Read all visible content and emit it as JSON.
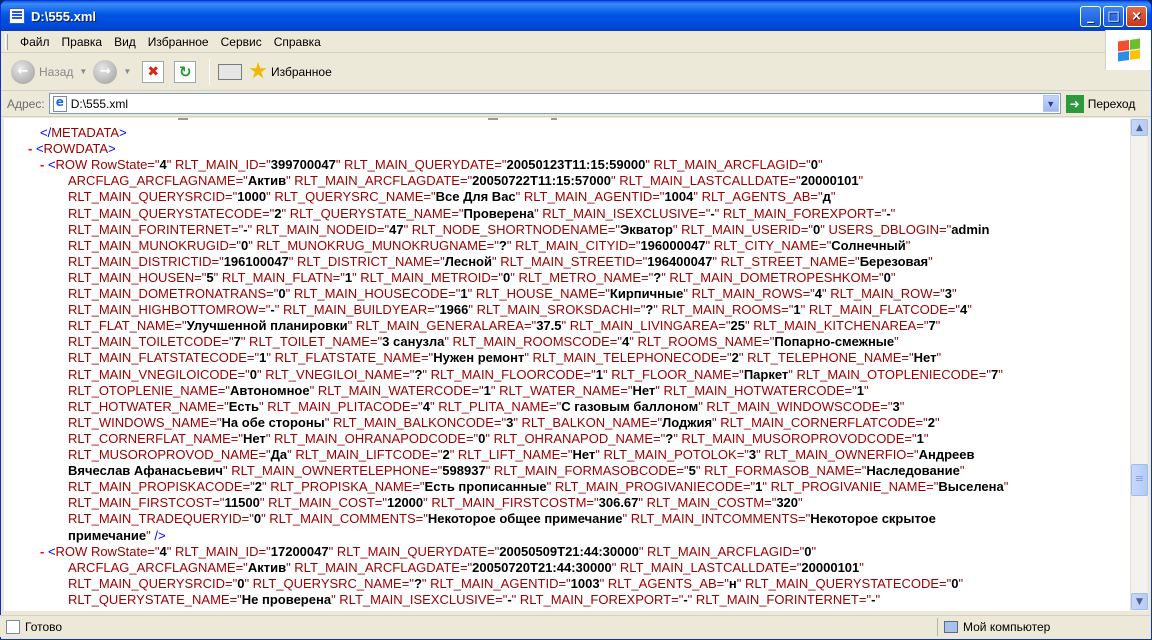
{
  "window": {
    "title": "D:\\555.xml"
  },
  "title_buttons": {
    "minimize": "_",
    "maximize": "□",
    "close": "×"
  },
  "menu": [
    "Файл",
    "Правка",
    "Вид",
    "Избранное",
    "Сервис",
    "Справка"
  ],
  "toolbar": {
    "back_label": "Назад",
    "favorites_label": "Избранное"
  },
  "address": {
    "label": "Адрес:",
    "value": "D:\\555.xml",
    "go_label": "Переход"
  },
  "status": {
    "left": "Готово",
    "right": "Мой компьютер"
  },
  "icons": [
    "windows-logo-icon",
    "back-arrow-icon",
    "forward-arrow-icon",
    "stop-icon",
    "refresh-icon",
    "media-icon",
    "favorites-star-icon",
    "page-icon",
    "go-arrow-icon",
    "my-computer-icon"
  ],
  "colors": {
    "markup": "#990000",
    "value": "#000000",
    "punct": "#0000ff",
    "minus": "#ff0000",
    "titlebar": "#0055e5"
  },
  "xml_lines": [
    [
      {
        "c": "p",
        "t": "</"
      },
      {
        "c": "t",
        "t": "METADATA"
      },
      {
        "c": "p",
        "t": ">"
      }
    ],
    [
      {
        "c": "minus",
        "t": "- "
      },
      {
        "c": "p",
        "t": "<"
      },
      {
        "c": "t",
        "t": "ROWDATA"
      },
      {
        "c": "p",
        "t": ">"
      }
    ],
    [
      {
        "c": "minus",
        "t": "- "
      },
      {
        "c": "p",
        "t": "<"
      },
      {
        "c": "t",
        "t": "ROW "
      },
      {
        "c": "a",
        "t": "RowState=\""
      },
      {
        "c": "v",
        "t": "4"
      },
      {
        "c": "a",
        "t": "\" RLT_MAIN_ID=\""
      },
      {
        "c": "v",
        "t": "399700047"
      },
      {
        "c": "a",
        "t": "\" RLT_MAIN_QUERYDATE=\""
      },
      {
        "c": "v",
        "t": "20050123T11:15:59000"
      },
      {
        "c": "a",
        "t": "\" RLT_MAIN_ARCFLAGID=\""
      },
      {
        "c": "v",
        "t": "0"
      },
      {
        "c": "a",
        "t": "\""
      }
    ],
    [
      {
        "c": "a",
        "t": "ARCFLAG_ARCFLAGNAME=\""
      },
      {
        "c": "v",
        "t": "Актив"
      },
      {
        "c": "a",
        "t": "\" RLT_MAIN_ARCFLAGDATE=\""
      },
      {
        "c": "v",
        "t": "20050722T11:15:57000"
      },
      {
        "c": "a",
        "t": "\" RLT_MAIN_LASTCALLDATE=\""
      },
      {
        "c": "v",
        "t": "20000101"
      },
      {
        "c": "a",
        "t": "\""
      }
    ],
    [
      {
        "c": "a",
        "t": "RLT_MAIN_QUERYSRCID=\""
      },
      {
        "c": "v",
        "t": "1000"
      },
      {
        "c": "a",
        "t": "\" RLT_QUERYSRC_NAME=\""
      },
      {
        "c": "v",
        "t": "Все Для Вас"
      },
      {
        "c": "a",
        "t": "\" RLT_MAIN_AGENTID=\""
      },
      {
        "c": "v",
        "t": "1004"
      },
      {
        "c": "a",
        "t": "\" RLT_AGENTS_AB=\""
      },
      {
        "c": "v",
        "t": "д"
      },
      {
        "c": "a",
        "t": "\""
      }
    ],
    [
      {
        "c": "a",
        "t": "RLT_MAIN_QUERYSTATECODE=\""
      },
      {
        "c": "v",
        "t": "2"
      },
      {
        "c": "a",
        "t": "\" RLT_QUERYSTATE_NAME=\""
      },
      {
        "c": "v",
        "t": "Проверена"
      },
      {
        "c": "a",
        "t": "\" RLT_MAIN_ISEXCLUSIVE=\""
      },
      {
        "c": "v",
        "t": "-"
      },
      {
        "c": "a",
        "t": "\" RLT_MAIN_FOREXPORT=\""
      },
      {
        "c": "v",
        "t": "-"
      },
      {
        "c": "a",
        "t": "\""
      }
    ],
    [
      {
        "c": "a",
        "t": "RLT_MAIN_FORINTERNET=\""
      },
      {
        "c": "v",
        "t": "-"
      },
      {
        "c": "a",
        "t": "\" RLT_MAIN_NODEID=\""
      },
      {
        "c": "v",
        "t": "47"
      },
      {
        "c": "a",
        "t": "\" RLT_NODE_SHORTNODENAME=\""
      },
      {
        "c": "v",
        "t": "Экватор"
      },
      {
        "c": "a",
        "t": "\" RLT_MAIN_USERID=\""
      },
      {
        "c": "v",
        "t": "0"
      },
      {
        "c": "a",
        "t": "\" USERS_DBLOGIN=\""
      },
      {
        "c": "v",
        "t": "admin"
      }
    ],
    [
      {
        "c": "a",
        "t": "RLT_MAIN_MUNOKRUGID=\""
      },
      {
        "c": "v",
        "t": "0"
      },
      {
        "c": "a",
        "t": "\" RLT_MUNOKRUG_MUNOKRUGNAME=\""
      },
      {
        "c": "v",
        "t": "?"
      },
      {
        "c": "a",
        "t": "\" RLT_MAIN_CITYID=\""
      },
      {
        "c": "v",
        "t": "196000047"
      },
      {
        "c": "a",
        "t": "\" RLT_CITY_NAME=\""
      },
      {
        "c": "v",
        "t": "Солнечный"
      },
      {
        "c": "a",
        "t": "\""
      }
    ],
    [
      {
        "c": "a",
        "t": "RLT_MAIN_DISTRICTID=\""
      },
      {
        "c": "v",
        "t": "196100047"
      },
      {
        "c": "a",
        "t": "\" RLT_DISTRICT_NAME=\""
      },
      {
        "c": "v",
        "t": "Лесной"
      },
      {
        "c": "a",
        "t": "\" RLT_MAIN_STREETID=\""
      },
      {
        "c": "v",
        "t": "196400047"
      },
      {
        "c": "a",
        "t": "\" RLT_STREET_NAME=\""
      },
      {
        "c": "v",
        "t": "Березовая"
      },
      {
        "c": "a",
        "t": "\""
      }
    ],
    [
      {
        "c": "a",
        "t": "RLT_MAIN_HOUSEN=\""
      },
      {
        "c": "v",
        "t": "5"
      },
      {
        "c": "a",
        "t": "\" RLT_MAIN_FLATN=\""
      },
      {
        "c": "v",
        "t": "1"
      },
      {
        "c": "a",
        "t": "\" RLT_MAIN_METROID=\""
      },
      {
        "c": "v",
        "t": "0"
      },
      {
        "c": "a",
        "t": "\" RLT_METRO_NAME=\""
      },
      {
        "c": "v",
        "t": "?"
      },
      {
        "c": "a",
        "t": "\" RLT_MAIN_DOMETROPESHKOM=\""
      },
      {
        "c": "v",
        "t": "0"
      },
      {
        "c": "a",
        "t": "\""
      }
    ],
    [
      {
        "c": "a",
        "t": "RLT_MAIN_DOMETRONATRANS=\""
      },
      {
        "c": "v",
        "t": "0"
      },
      {
        "c": "a",
        "t": "\" RLT_MAIN_HOUSECODE=\""
      },
      {
        "c": "v",
        "t": "1"
      },
      {
        "c": "a",
        "t": "\" RLT_HOUSE_NAME=\""
      },
      {
        "c": "v",
        "t": "Кирпичные"
      },
      {
        "c": "a",
        "t": "\" RLT_MAIN_ROWS=\""
      },
      {
        "c": "v",
        "t": "4"
      },
      {
        "c": "a",
        "t": "\" RLT_MAIN_ROW=\""
      },
      {
        "c": "v",
        "t": "3"
      },
      {
        "c": "a",
        "t": "\""
      }
    ],
    [
      {
        "c": "a",
        "t": "RLT_MAIN_HIGHBOTTOMROW=\""
      },
      {
        "c": "v",
        "t": "-"
      },
      {
        "c": "a",
        "t": "\" RLT_MAIN_BUILDYEAR=\""
      },
      {
        "c": "v",
        "t": "1966"
      },
      {
        "c": "a",
        "t": "\" RLT_MAIN_SROKSDACHI=\""
      },
      {
        "c": "v",
        "t": "?"
      },
      {
        "c": "a",
        "t": "\" RLT_MAIN_ROOMS=\""
      },
      {
        "c": "v",
        "t": "1"
      },
      {
        "c": "a",
        "t": "\" RLT_MAIN_FLATCODE=\""
      },
      {
        "c": "v",
        "t": "4"
      },
      {
        "c": "a",
        "t": "\""
      }
    ],
    [
      {
        "c": "a",
        "t": "RLT_FLAT_NAME=\""
      },
      {
        "c": "v",
        "t": "Улучшенной планировки"
      },
      {
        "c": "a",
        "t": "\" RLT_MAIN_GENERALAREA=\""
      },
      {
        "c": "v",
        "t": "37.5"
      },
      {
        "c": "a",
        "t": "\" RLT_MAIN_LIVINGAREA=\""
      },
      {
        "c": "v",
        "t": "25"
      },
      {
        "c": "a",
        "t": "\" RLT_MAIN_KITCHENAREA=\""
      },
      {
        "c": "v",
        "t": "7"
      },
      {
        "c": "a",
        "t": "\""
      }
    ],
    [
      {
        "c": "a",
        "t": "RLT_MAIN_TOILETCODE=\""
      },
      {
        "c": "v",
        "t": "7"
      },
      {
        "c": "a",
        "t": "\" RLT_TOILET_NAME=\""
      },
      {
        "c": "v",
        "t": "3 санузла"
      },
      {
        "c": "a",
        "t": "\" RLT_MAIN_ROOMSCODE=\""
      },
      {
        "c": "v",
        "t": "4"
      },
      {
        "c": "a",
        "t": "\" RLT_ROOMS_NAME=\""
      },
      {
        "c": "v",
        "t": "Попарно-смежные"
      },
      {
        "c": "a",
        "t": "\""
      }
    ],
    [
      {
        "c": "a",
        "t": "RLT_MAIN_FLATSTATECODE=\""
      },
      {
        "c": "v",
        "t": "1"
      },
      {
        "c": "a",
        "t": "\" RLT_FLATSTATE_NAME=\""
      },
      {
        "c": "v",
        "t": "Нужен ремонт"
      },
      {
        "c": "a",
        "t": "\" RLT_MAIN_TELEPHONECODE=\""
      },
      {
        "c": "v",
        "t": "2"
      },
      {
        "c": "a",
        "t": "\" RLT_TELEPHONE_NAME=\""
      },
      {
        "c": "v",
        "t": "Нет"
      },
      {
        "c": "a",
        "t": "\""
      }
    ],
    [
      {
        "c": "a",
        "t": "RLT_MAIN_VNEGILOICODE=\""
      },
      {
        "c": "v",
        "t": "0"
      },
      {
        "c": "a",
        "t": "\" RLT_VNEGILOI_NAME=\""
      },
      {
        "c": "v",
        "t": "?"
      },
      {
        "c": "a",
        "t": "\" RLT_MAIN_FLOORCODE=\""
      },
      {
        "c": "v",
        "t": "1"
      },
      {
        "c": "a",
        "t": "\" RLT_FLOOR_NAME=\""
      },
      {
        "c": "v",
        "t": "Паркет"
      },
      {
        "c": "a",
        "t": "\" RLT_MAIN_OTOPLENIECODE=\""
      },
      {
        "c": "v",
        "t": "7"
      },
      {
        "c": "a",
        "t": "\""
      }
    ],
    [
      {
        "c": "a",
        "t": "RLT_OTOPLENIE_NAME=\""
      },
      {
        "c": "v",
        "t": "Автономное"
      },
      {
        "c": "a",
        "t": "\" RLT_MAIN_WATERCODE=\""
      },
      {
        "c": "v",
        "t": "1"
      },
      {
        "c": "a",
        "t": "\" RLT_WATER_NAME=\""
      },
      {
        "c": "v",
        "t": "Нет"
      },
      {
        "c": "a",
        "t": "\" RLT_MAIN_HOTWATERCODE=\""
      },
      {
        "c": "v",
        "t": "1"
      },
      {
        "c": "a",
        "t": "\""
      }
    ],
    [
      {
        "c": "a",
        "t": "RLT_HOTWATER_NAME=\""
      },
      {
        "c": "v",
        "t": "Есть"
      },
      {
        "c": "a",
        "t": "\" RLT_MAIN_PLITACODE=\""
      },
      {
        "c": "v",
        "t": "4"
      },
      {
        "c": "a",
        "t": "\" RLT_PLITA_NAME=\""
      },
      {
        "c": "v",
        "t": "С газовым баллоном"
      },
      {
        "c": "a",
        "t": "\" RLT_MAIN_WINDOWSCODE=\""
      },
      {
        "c": "v",
        "t": "3"
      },
      {
        "c": "a",
        "t": "\""
      }
    ],
    [
      {
        "c": "a",
        "t": "RLT_WINDOWS_NAME=\""
      },
      {
        "c": "v",
        "t": "На обе стороны"
      },
      {
        "c": "a",
        "t": "\" RLT_MAIN_BALKONCODE=\""
      },
      {
        "c": "v",
        "t": "3"
      },
      {
        "c": "a",
        "t": "\" RLT_BALKON_NAME=\""
      },
      {
        "c": "v",
        "t": "Лоджия"
      },
      {
        "c": "a",
        "t": "\" RLT_MAIN_CORNERFLATCODE=\""
      },
      {
        "c": "v",
        "t": "2"
      },
      {
        "c": "a",
        "t": "\""
      }
    ],
    [
      {
        "c": "a",
        "t": "RLT_CORNERFLAT_NAME=\""
      },
      {
        "c": "v",
        "t": "Нет"
      },
      {
        "c": "a",
        "t": "\" RLT_MAIN_OHRANAPODCODE=\""
      },
      {
        "c": "v",
        "t": "0"
      },
      {
        "c": "a",
        "t": "\" RLT_OHRANAPOD_NAME=\""
      },
      {
        "c": "v",
        "t": "?"
      },
      {
        "c": "a",
        "t": "\" RLT_MAIN_MUSOROPROVODCODE=\""
      },
      {
        "c": "v",
        "t": "1"
      },
      {
        "c": "a",
        "t": "\""
      }
    ],
    [
      {
        "c": "a",
        "t": "RLT_MUSOROPROVOD_NAME=\""
      },
      {
        "c": "v",
        "t": "Да"
      },
      {
        "c": "a",
        "t": "\" RLT_MAIN_LIFTCODE=\""
      },
      {
        "c": "v",
        "t": "2"
      },
      {
        "c": "a",
        "t": "\" RLT_LIFT_NAME=\""
      },
      {
        "c": "v",
        "t": "Нет"
      },
      {
        "c": "a",
        "t": "\" RLT_MAIN_POTOLOK=\""
      },
      {
        "c": "v",
        "t": "3"
      },
      {
        "c": "a",
        "t": "\" RLT_MAIN_OWNERFIO=\""
      },
      {
        "c": "v",
        "t": "Андреев"
      }
    ],
    [
      {
        "c": "v",
        "t": "Вячеслав Афанасьевич"
      },
      {
        "c": "a",
        "t": "\" RLT_MAIN_OWNERTELEPHONE=\""
      },
      {
        "c": "v",
        "t": "598937"
      },
      {
        "c": "a",
        "t": "\" RLT_MAIN_FORMASOBCODE=\""
      },
      {
        "c": "v",
        "t": "5"
      },
      {
        "c": "a",
        "t": "\" RLT_FORMASOB_NAME=\""
      },
      {
        "c": "v",
        "t": "Наследование"
      },
      {
        "c": "a",
        "t": "\""
      }
    ],
    [
      {
        "c": "a",
        "t": "RLT_MAIN_PROPISKACODE=\""
      },
      {
        "c": "v",
        "t": "2"
      },
      {
        "c": "a",
        "t": "\" RLT_PROPISKA_NAME=\""
      },
      {
        "c": "v",
        "t": "Есть прописанные"
      },
      {
        "c": "a",
        "t": "\" RLT_MAIN_PROGIVANIECODE=\""
      },
      {
        "c": "v",
        "t": "1"
      },
      {
        "c": "a",
        "t": "\" RLT_PROGIVANIE_NAME=\""
      },
      {
        "c": "v",
        "t": "Выселена"
      },
      {
        "c": "a",
        "t": "\""
      }
    ],
    [
      {
        "c": "a",
        "t": "RLT_MAIN_FIRSTCOST=\""
      },
      {
        "c": "v",
        "t": "11500"
      },
      {
        "c": "a",
        "t": "\" RLT_MAIN_COST=\""
      },
      {
        "c": "v",
        "t": "12000"
      },
      {
        "c": "a",
        "t": "\" RLT_MAIN_FIRSTCOSTM=\""
      },
      {
        "c": "v",
        "t": "306.67"
      },
      {
        "c": "a",
        "t": "\" RLT_MAIN_COSTM=\""
      },
      {
        "c": "v",
        "t": "320"
      },
      {
        "c": "a",
        "t": "\""
      }
    ],
    [
      {
        "c": "a",
        "t": "RLT_MAIN_TRADEQUERYID=\""
      },
      {
        "c": "v",
        "t": "0"
      },
      {
        "c": "a",
        "t": "\" RLT_MAIN_COMMENTS=\""
      },
      {
        "c": "v",
        "t": "Некоторое общее примечание"
      },
      {
        "c": "a",
        "t": "\" RLT_MAIN_INTCOMMENTS=\""
      },
      {
        "c": "v",
        "t": "Некоторое скрытое"
      }
    ],
    [
      {
        "c": "v",
        "t": "примечание"
      },
      {
        "c": "a",
        "t": "\" "
      },
      {
        "c": "p",
        "t": "/>"
      }
    ],
    [
      {
        "c": "minus",
        "t": "- "
      },
      {
        "c": "p",
        "t": "<"
      },
      {
        "c": "t",
        "t": "ROW "
      },
      {
        "c": "a",
        "t": "RowState=\""
      },
      {
        "c": "v",
        "t": "4"
      },
      {
        "c": "a",
        "t": "\" RLT_MAIN_ID=\""
      },
      {
        "c": "v",
        "t": "17200047"
      },
      {
        "c": "a",
        "t": "\" RLT_MAIN_QUERYDATE=\""
      },
      {
        "c": "v",
        "t": "20050509T21:44:30000"
      },
      {
        "c": "a",
        "t": "\" RLT_MAIN_ARCFLAGID=\""
      },
      {
        "c": "v",
        "t": "0"
      },
      {
        "c": "a",
        "t": "\""
      }
    ],
    [
      {
        "c": "a",
        "t": "ARCFLAG_ARCFLAGNAME=\""
      },
      {
        "c": "v",
        "t": "Актив"
      },
      {
        "c": "a",
        "t": "\" RLT_MAIN_ARCFLAGDATE=\""
      },
      {
        "c": "v",
        "t": "20050720T21:44:30000"
      },
      {
        "c": "a",
        "t": "\" RLT_MAIN_LASTCALLDATE=\""
      },
      {
        "c": "v",
        "t": "20000101"
      },
      {
        "c": "a",
        "t": "\""
      }
    ],
    [
      {
        "c": "a",
        "t": "RLT_MAIN_QUERYSRCID=\""
      },
      {
        "c": "v",
        "t": "0"
      },
      {
        "c": "a",
        "t": "\" RLT_QUERYSRC_NAME=\""
      },
      {
        "c": "v",
        "t": "?"
      },
      {
        "c": "a",
        "t": "\" RLT_MAIN_AGENTID=\""
      },
      {
        "c": "v",
        "t": "1003"
      },
      {
        "c": "a",
        "t": "\" RLT_AGENTS_AB=\""
      },
      {
        "c": "v",
        "t": "н"
      },
      {
        "c": "a",
        "t": "\" RLT_MAIN_QUERYSTATECODE=\""
      },
      {
        "c": "v",
        "t": "0"
      },
      {
        "c": "a",
        "t": "\""
      }
    ],
    [
      {
        "c": "a",
        "t": "RLT_QUERYSTATE_NAME=\""
      },
      {
        "c": "v",
        "t": "Не проверена"
      },
      {
        "c": "a",
        "t": "\" RLT_MAIN_ISEXCLUSIVE=\""
      },
      {
        "c": "v",
        "t": "-"
      },
      {
        "c": "a",
        "t": "\" RLT_MAIN_FOREXPORT=\""
      },
      {
        "c": "v",
        "t": "-"
      },
      {
        "c": "a",
        "t": "\" RLT_MAIN_FORINTERNET=\""
      },
      {
        "c": "v",
        "t": "-"
      },
      {
        "c": "a",
        "t": "\""
      }
    ]
  ]
}
